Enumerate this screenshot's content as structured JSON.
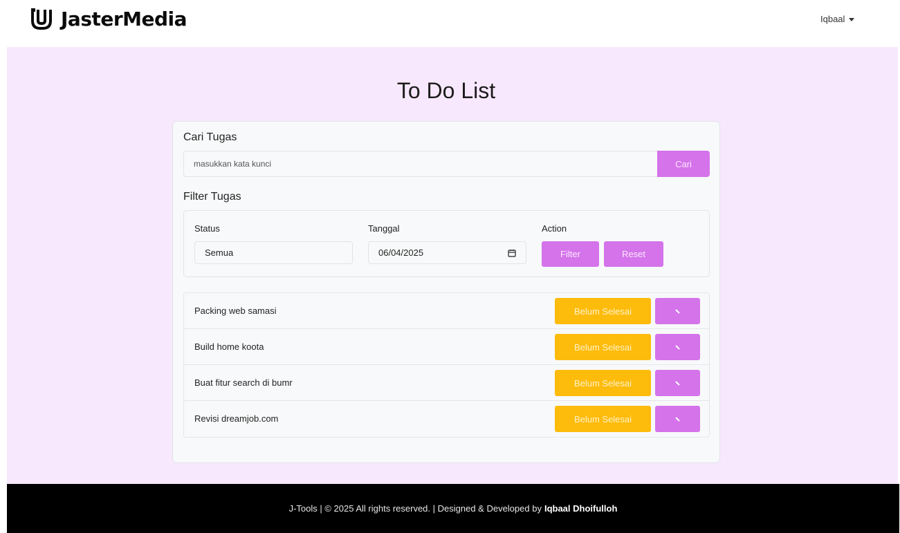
{
  "navbar": {
    "brand_name": "JasterMedia",
    "user_name": "Iqbaal"
  },
  "page": {
    "title": "To Do List"
  },
  "search": {
    "label": "Cari Tugas",
    "placeholder": "masukkan kata kunci",
    "button_label": "Cari"
  },
  "filter": {
    "label": "Filter Tugas",
    "status_label": "Status",
    "status_value": "Semua",
    "date_label": "Tanggal",
    "date_value": "06/04/2025",
    "action_label": "Action",
    "filter_button": "Filter",
    "reset_button": "Reset"
  },
  "tasks": [
    {
      "name": "Packing web samasi",
      "status": "Belum Selesai"
    },
    {
      "name": "Build home koota",
      "status": "Belum Selesai"
    },
    {
      "name": "Buat fitur search di bumr",
      "status": "Belum Selesai"
    },
    {
      "name": "Revisi dreamjob.com",
      "status": "Belum Selesai"
    }
  ],
  "footer": {
    "text": "J-Tools | © 2025 All rights reserved. | Designed & Developed by",
    "author": "Iqbaal Dhoifulloh"
  },
  "colors": {
    "accent": "#d473ea",
    "status_pending": "#fdbb0c",
    "page_background": "#f8e8fd",
    "footer_background": "#000000"
  }
}
